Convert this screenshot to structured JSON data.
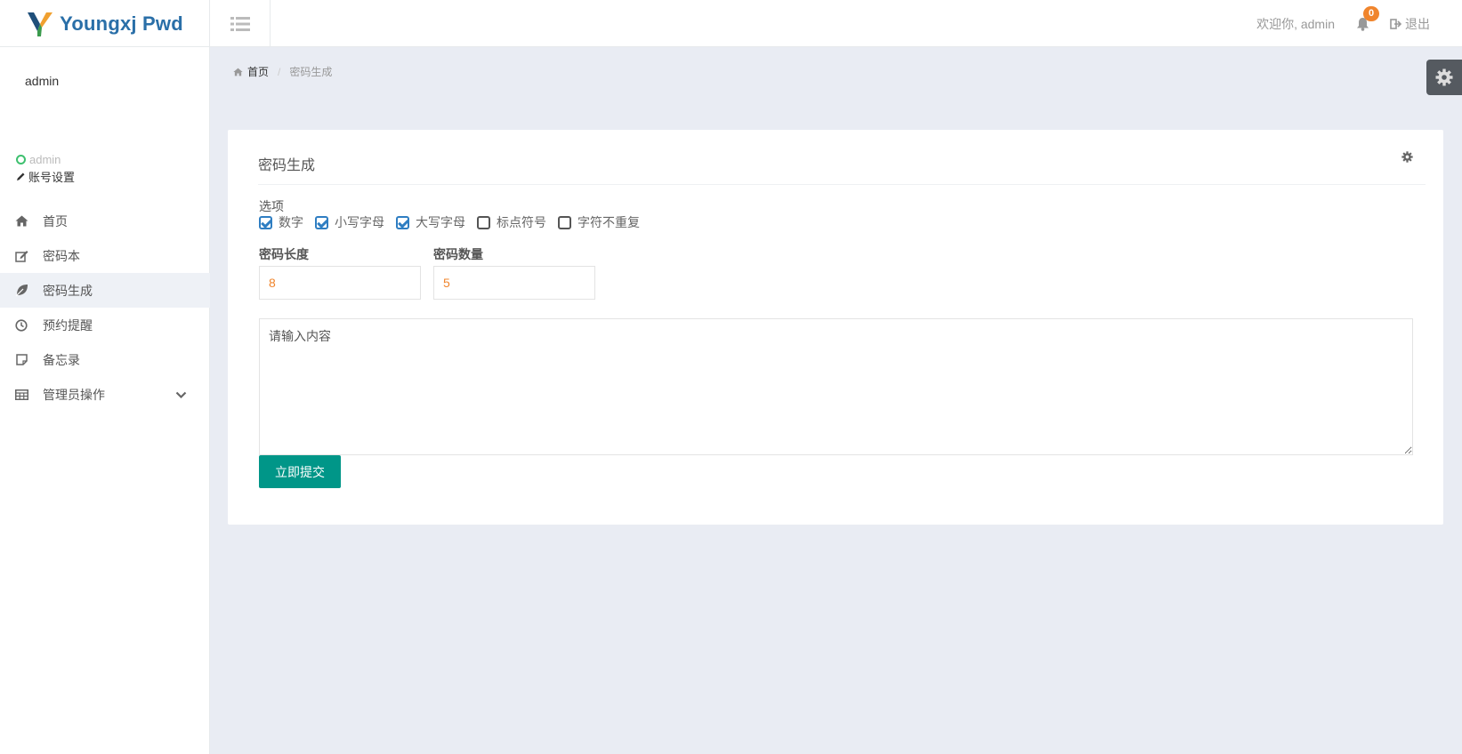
{
  "header": {
    "brand_name": "Youngxj Pwd",
    "welcome_text": "欢迎你, admin",
    "notification_count": "0",
    "logout_label": "退出",
    "accent_color": "#f0852d"
  },
  "sidebar": {
    "avatar_alt": "admin",
    "username": "admin",
    "account_settings": "账号设置",
    "items": [
      {
        "label": "首页",
        "icon": "home-icon",
        "active": false
      },
      {
        "label": "密码本",
        "icon": "edit-icon",
        "active": false
      },
      {
        "label": "密码生成",
        "icon": "leaf-icon",
        "active": true
      },
      {
        "label": "预约提醒",
        "icon": "clock-icon",
        "active": false
      },
      {
        "label": "备忘录",
        "icon": "sticky-note-icon",
        "active": false
      },
      {
        "label": "管理员操作",
        "icon": "table-icon",
        "active": false,
        "expandable": true
      }
    ]
  },
  "breadcrumb": {
    "home": "首页",
    "current": "密码生成"
  },
  "card": {
    "title": "密码生成",
    "options_label": "选项",
    "options": [
      {
        "label": "数字",
        "checked": true
      },
      {
        "label": "小写字母",
        "checked": true
      },
      {
        "label": "大写字母",
        "checked": true
      },
      {
        "label": "标点符号",
        "checked": false
      },
      {
        "label": "字符不重复",
        "checked": false
      }
    ],
    "length_label": "密码长度",
    "length_value": "8",
    "count_label": "密码数量",
    "count_value": "5",
    "content_placeholder": "请输入内容",
    "submit_label": "立即提交",
    "submit_color": "#009688"
  }
}
